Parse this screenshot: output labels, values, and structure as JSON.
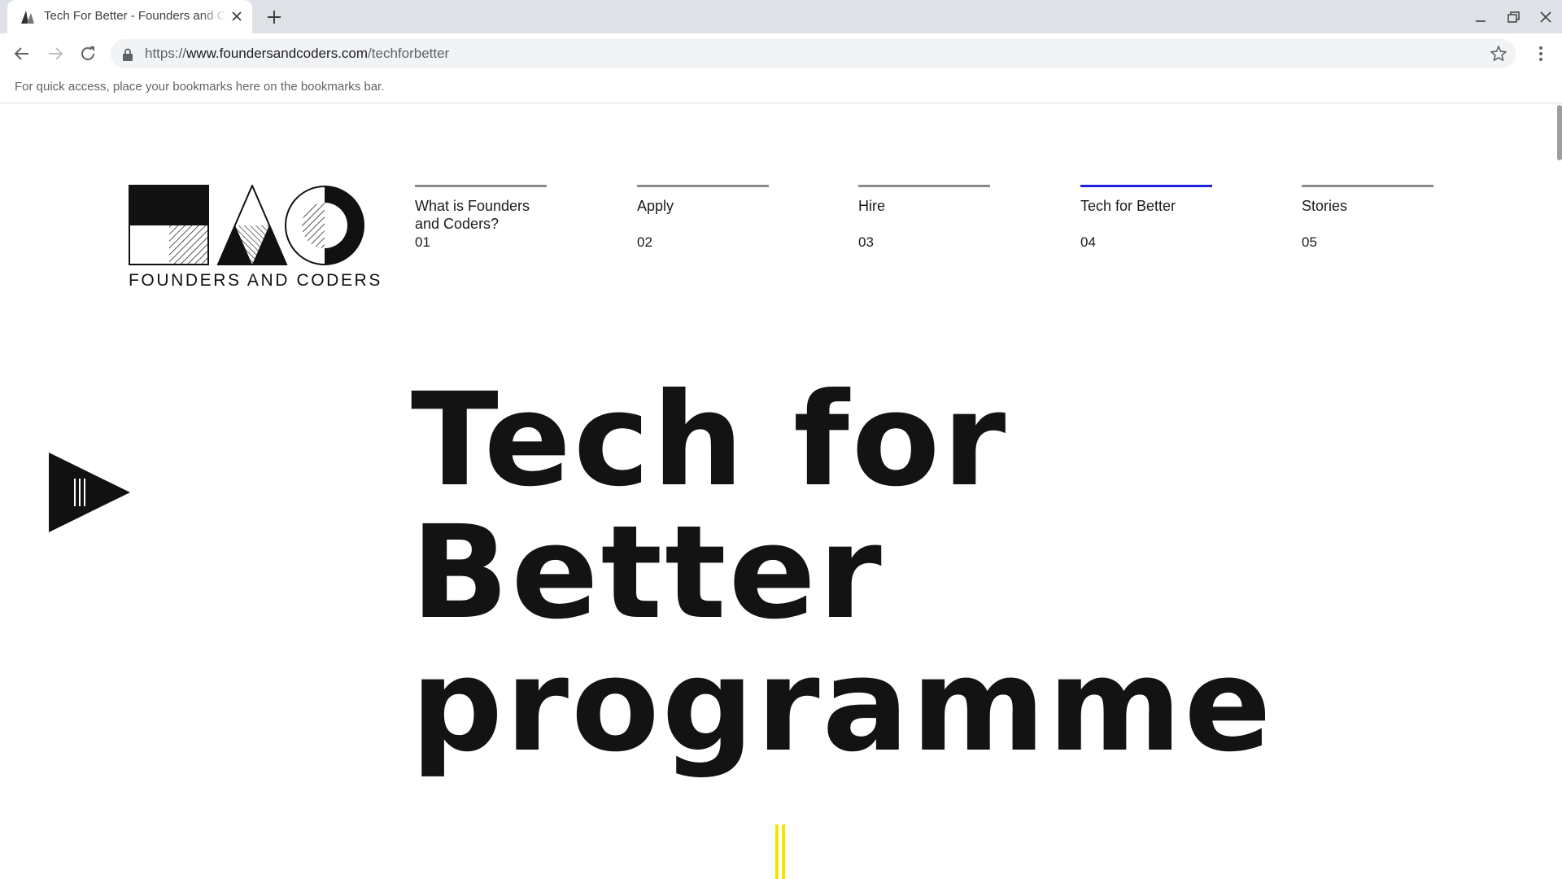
{
  "browser": {
    "tab_title": "Tech For Better - Founders and Coders",
    "url_scheme": "https://",
    "url_host": "www.foundersandcoders.com",
    "url_path": "/techforbetter",
    "bookmarks_hint": "For quick access, place your bookmarks here on the bookmarks bar."
  },
  "site": {
    "logo_text": "FOUNDERS AND CODERS",
    "nav": [
      {
        "label": "What is Founders and Coders?",
        "number": "01",
        "active": false
      },
      {
        "label": "Apply",
        "number": "02",
        "active": false
      },
      {
        "label": "Hire",
        "number": "03",
        "active": false
      },
      {
        "label": "Tech for Better",
        "number": "04",
        "active": true
      },
      {
        "label": "Stories",
        "number": "05",
        "active": false
      }
    ],
    "hero_lines": [
      "Tech for",
      "Better",
      "programme"
    ]
  },
  "colors": {
    "nav_active_bar": "#2222dd",
    "nav_bar": "#8a8a8a",
    "scroll_marker": "#f5e400",
    "text": "#131313"
  },
  "icons": {
    "play": "play-icon",
    "scroll_marker": "scroll-down-marker"
  }
}
